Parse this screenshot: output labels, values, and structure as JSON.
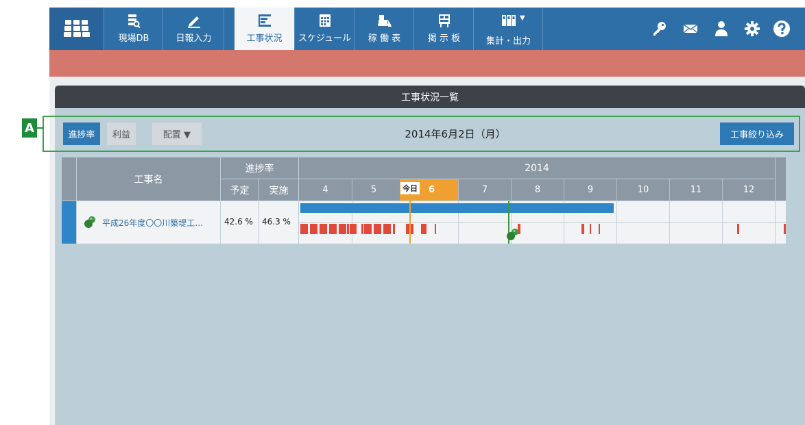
{
  "nav": {
    "items": [
      {
        "label": "現場DB",
        "icon": "database-search-icon"
      },
      {
        "label": "日報入力",
        "icon": "pen-icon"
      },
      {
        "label": "工事状況",
        "icon": "gantt-icon"
      },
      {
        "label": "スケジュール",
        "icon": "calendar-icon"
      },
      {
        "label": "稼 働 表",
        "icon": "bulldozer-icon"
      },
      {
        "label": "掲 示 板",
        "icon": "bulletin-board-icon"
      },
      {
        "label": "集計・出力",
        "icon": "report-icon"
      }
    ],
    "right_icons": [
      "key-icon",
      "mail-icon",
      "user-icon",
      "gear-icon",
      "help-icon"
    ]
  },
  "panel": {
    "title": "工事状況一覧"
  },
  "toolbar": {
    "progress": "進捗率",
    "profit": "利益",
    "layout": "配置 ▼",
    "date": "2014年6月2日（月）",
    "filter": "工事絞り込み"
  },
  "annotation": {
    "marker": "A"
  },
  "table": {
    "col_name": "工事名",
    "col_progress": "進捗率",
    "col_planned": "予定",
    "col_actual": "実施",
    "year": "2014",
    "months": [
      "4",
      "5",
      "6",
      "7",
      "8",
      "9",
      "10",
      "11",
      "12"
    ],
    "today_label": "今日",
    "current_month": "6",
    "rows": [
      {
        "name": "平成26年度〇〇川築堤工…",
        "planned": "42.6 %",
        "actual": "46.3 %"
      }
    ]
  },
  "colors": {
    "nav": "#2e6fa8",
    "alert": "#d4776d",
    "plan_bar": "#2e86c8",
    "work_bar": "#e2493b",
    "today": "#f0a030",
    "milestone": "#3a9a40"
  }
}
